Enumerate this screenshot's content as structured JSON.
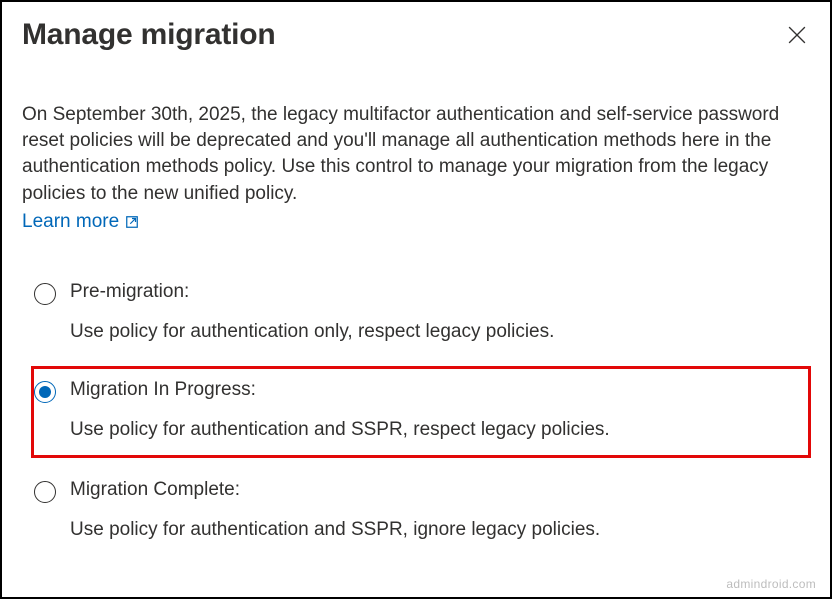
{
  "header": {
    "title": "Manage migration"
  },
  "description": "On September 30th, 2025, the legacy multifactor authentication and self-service password reset policies will be deprecated and you'll manage all authentication methods here in the authentication methods policy. Use this control to manage your migration from the legacy policies to the new unified policy.",
  "learn_more": "Learn more",
  "options": [
    {
      "title": "Pre-migration:",
      "desc": "Use policy for authentication only, respect legacy policies.",
      "selected": false,
      "highlighted": false
    },
    {
      "title": "Migration In Progress:",
      "desc": "Use policy for authentication and SSPR, respect legacy policies.",
      "selected": true,
      "highlighted": true
    },
    {
      "title": "Migration Complete:",
      "desc": "Use policy for authentication and SSPR, ignore legacy policies.",
      "selected": false,
      "highlighted": false
    }
  ],
  "watermark": "admindroid.com"
}
